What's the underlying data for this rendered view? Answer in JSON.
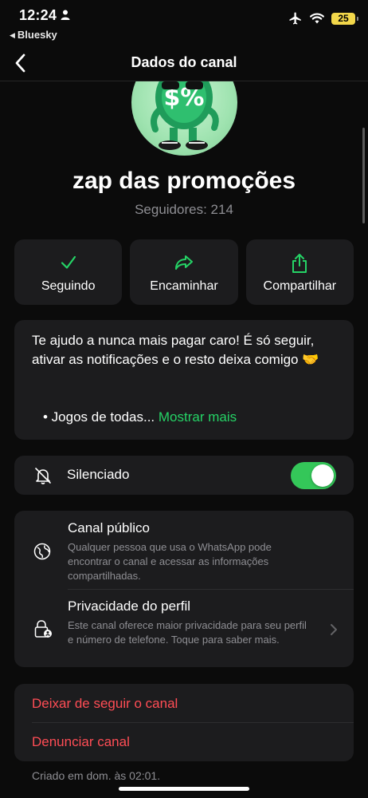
{
  "status_bar": {
    "time": "12:24",
    "back_app": "Bluesky",
    "battery": "25"
  },
  "nav": {
    "title": "Dados do canal"
  },
  "channel": {
    "name": "zap das promoções",
    "followers": "Seguidores: 214",
    "avatar_text": "$%"
  },
  "actions": [
    {
      "label": "Seguindo",
      "icon": "check-icon"
    },
    {
      "label": "Encaminhar",
      "icon": "forward-arrow-icon"
    },
    {
      "label": "Compartilhar",
      "icon": "share-icon"
    }
  ],
  "description": {
    "text": "Te ajudo a nunca mais pagar caro! É só seguir, ativar as notificações e o resto deixa comigo 🤝",
    "bullet": "• Jogos de todas...",
    "show_more": "Mostrar mais"
  },
  "muted": {
    "label": "Silenciado",
    "enabled": true
  },
  "info": {
    "public": {
      "title": "Canal público",
      "subtitle": "Qualquer pessoa que usa o WhatsApp pode encontrar o canal e acessar as informações compartilhadas."
    },
    "privacy": {
      "title": "Privacidade do perfil",
      "subtitle": "Este canal oferece maior privacidade para seu perfil e número de telefone. Toque para saber mais."
    }
  },
  "danger": {
    "unfollow": "Deixar de seguir o canal",
    "report": "Denunciar canal"
  },
  "footer": {
    "created": "Criado em dom. às 02:01."
  },
  "colors": {
    "accent_green": "#25d366",
    "toggle_green": "#34c759",
    "danger_red": "#ff4d55",
    "card_bg": "#1c1c1e"
  }
}
